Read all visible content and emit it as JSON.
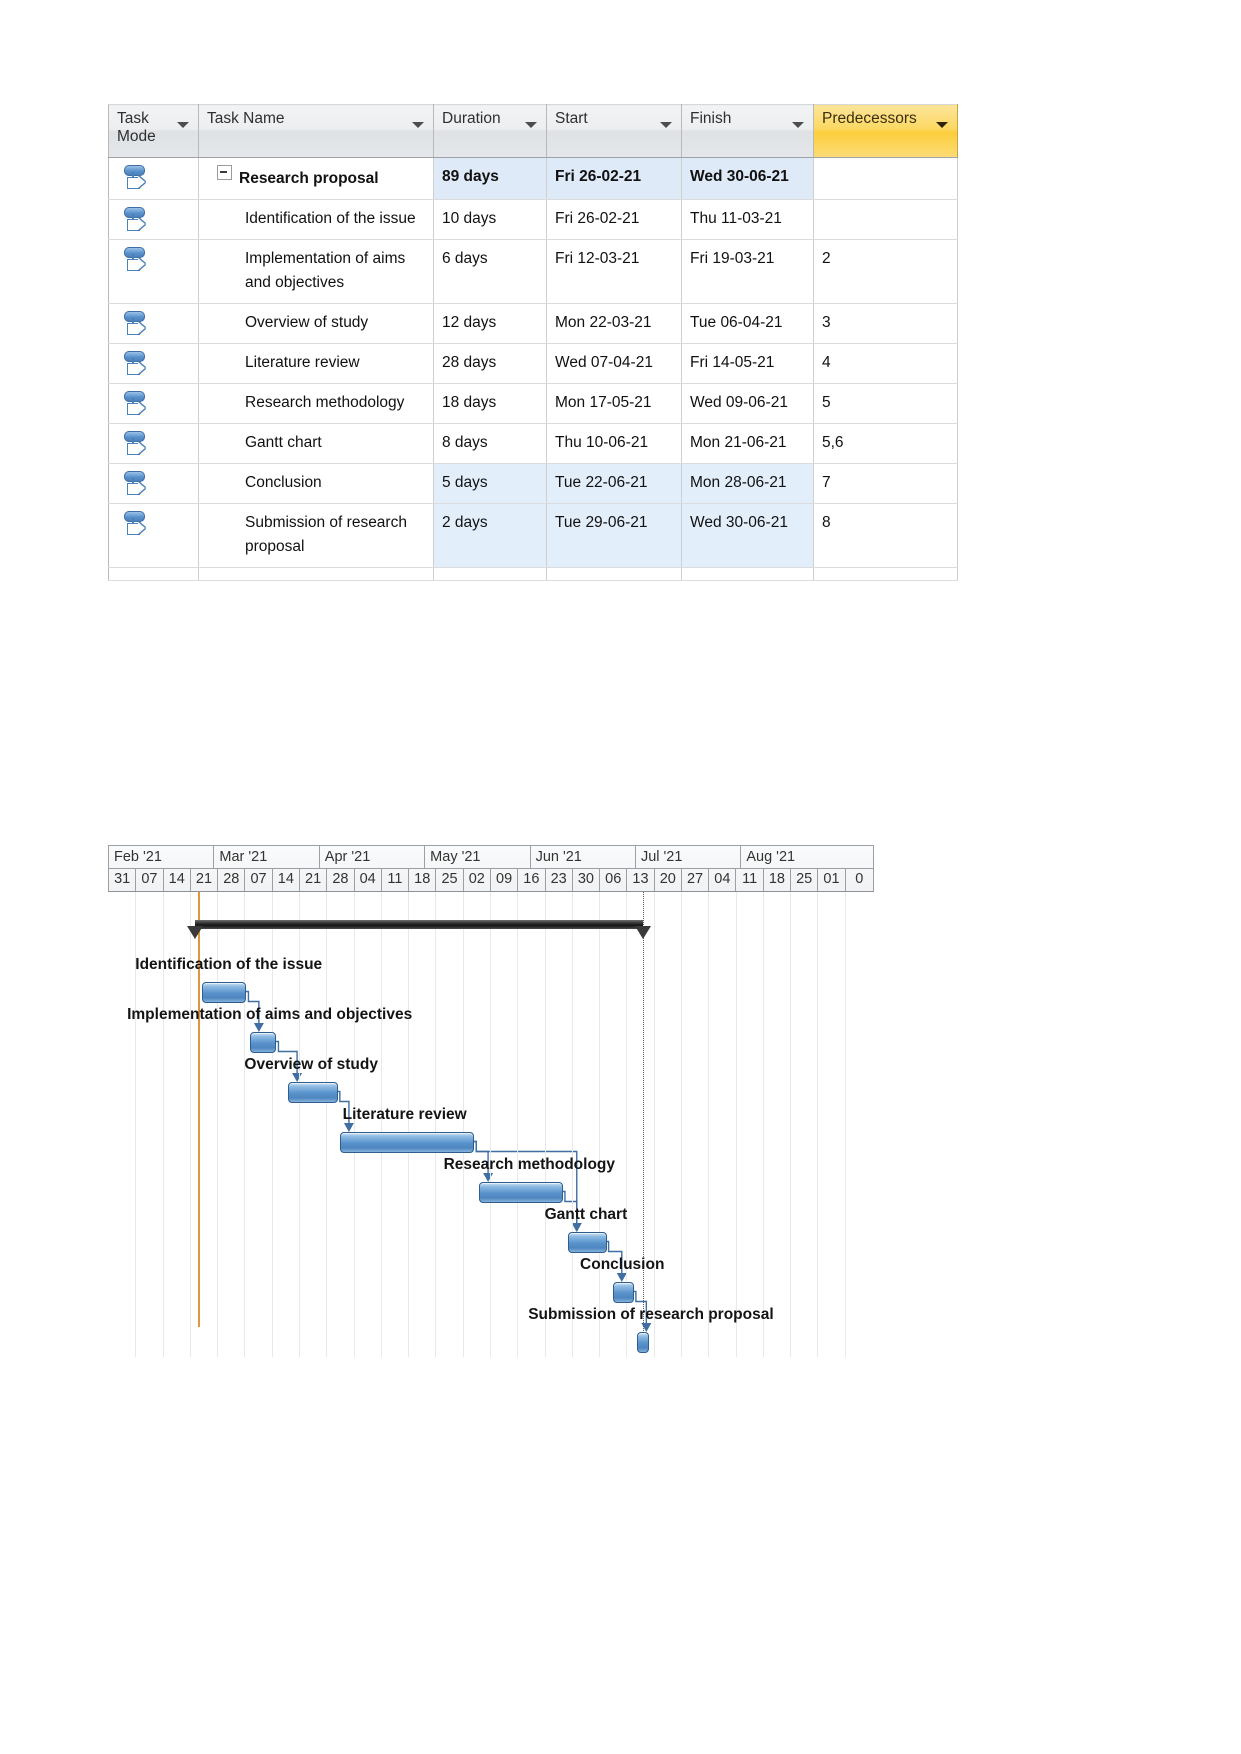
{
  "table": {
    "columns": [
      {
        "key": "mode",
        "label": "Task Mode"
      },
      {
        "key": "name",
        "label": "Task Name"
      },
      {
        "key": "dur",
        "label": "Duration"
      },
      {
        "key": "start",
        "label": "Start"
      },
      {
        "key": "finish",
        "label": "Finish"
      },
      {
        "key": "pred",
        "label": "Predecessors"
      }
    ],
    "header_highlight_color": "#fbce3c",
    "row_highlight_color": "#e3eefb",
    "rows": [
      {
        "id": 1,
        "name": "Research proposal",
        "dur": "89 days",
        "start": "Fri 26-02-21",
        "finish": "Wed 30-06-21",
        "pred": "",
        "summary": true,
        "indent": false,
        "highlight": true,
        "mode_icon": "auto-schedule-icon"
      },
      {
        "id": 2,
        "name": "Identification of the issue",
        "dur": "10 days",
        "start": "Fri 26-02-21",
        "finish": "Thu 11-03-21",
        "pred": "",
        "summary": false,
        "indent": true,
        "highlight": false,
        "mode_icon": "auto-schedule-icon"
      },
      {
        "id": 3,
        "name": "Implementation of aims and objectives",
        "dur": "6 days",
        "start": "Fri 12-03-21",
        "finish": "Fri 19-03-21",
        "pred": "2",
        "summary": false,
        "indent": true,
        "highlight": false,
        "mode_icon": "auto-schedule-icon"
      },
      {
        "id": 4,
        "name": "Overview of study",
        "dur": "12 days",
        "start": "Mon 22-03-21",
        "finish": "Tue 06-04-21",
        "pred": "3",
        "summary": false,
        "indent": true,
        "highlight": false,
        "mode_icon": "auto-schedule-icon"
      },
      {
        "id": 5,
        "name": "Literature review",
        "dur": "28 days",
        "start": "Wed 07-04-21",
        "finish": "Fri 14-05-21",
        "pred": "4",
        "summary": false,
        "indent": true,
        "highlight": false,
        "mode_icon": "auto-schedule-icon"
      },
      {
        "id": 6,
        "name": "Research methodology",
        "dur": "18 days",
        "start": "Mon 17-05-21",
        "finish": "Wed 09-06-21",
        "pred": "5",
        "summary": false,
        "indent": true,
        "highlight": false,
        "mode_icon": "auto-schedule-icon"
      },
      {
        "id": 7,
        "name": "Gantt chart",
        "dur": "8 days",
        "start": "Thu 10-06-21",
        "finish": "Mon 21-06-21",
        "pred": "5,6",
        "summary": false,
        "indent": true,
        "highlight": false,
        "mode_icon": "auto-schedule-icon"
      },
      {
        "id": 8,
        "name": "Conclusion",
        "dur": "5 days",
        "start": "Tue 22-06-21",
        "finish": "Mon 28-06-21",
        "pred": "7",
        "summary": false,
        "indent": true,
        "highlight": true,
        "mode_icon": "auto-schedule-icon"
      },
      {
        "id": 9,
        "name": "Submission of research proposal",
        "dur": "2 days",
        "start": "Tue 29-06-21",
        "finish": "Wed 30-06-21",
        "pred": "8",
        "summary": false,
        "indent": true,
        "highlight": true,
        "mode_icon": "auto-schedule-icon"
      }
    ]
  },
  "chart_data": {
    "type": "bar",
    "title": "",
    "timescale": {
      "months": [
        {
          "label": "Feb '21",
          "weeks": 4
        },
        {
          "label": "Mar '21",
          "weeks": 4
        },
        {
          "label": "Apr '21",
          "weeks": 4
        },
        {
          "label": "May '21",
          "weeks": 4
        },
        {
          "label": "Jun '21",
          "weeks": 4
        },
        {
          "label": "Jul '21",
          "weeks": 4
        },
        {
          "label": "Aug '21",
          "weeks": 5
        }
      ],
      "weeks": [
        "31",
        "07",
        "14",
        "21",
        "28",
        "07",
        "14",
        "21",
        "28",
        "04",
        "11",
        "18",
        "25",
        "02",
        "09",
        "16",
        "23",
        "30",
        "06",
        "13",
        "20",
        "27",
        "04",
        "11",
        "18",
        "25",
        "01",
        "0"
      ]
    },
    "summary_bar": {
      "label": "Research proposal",
      "start_week": 3.2,
      "end_week": 19.6
    },
    "today_marker_week": 3.3,
    "deadline_marker_week": 19.6,
    "bars": [
      {
        "name": "Identification of the issue",
        "start_week": 3.45,
        "end_week": 5.0,
        "label_x_week": 1.0
      },
      {
        "name": "Implementation of aims and objectives",
        "start_week": 5.2,
        "end_week": 6.1,
        "label_x_week": 0.7
      },
      {
        "name": "Overview of study",
        "start_week": 6.6,
        "end_week": 8.35,
        "label_x_week": 5.0
      },
      {
        "name": "Literature review",
        "start_week": 8.5,
        "end_week": 13.35,
        "label_x_week": 8.6
      },
      {
        "name": "Research methodology",
        "start_week": 13.6,
        "end_week": 16.6,
        "label_x_week": 12.3
      },
      {
        "name": "Gantt chart",
        "start_week": 16.85,
        "end_week": 18.2,
        "label_x_week": 16.0
      },
      {
        "name": "Conclusion",
        "start_week": 18.5,
        "end_week": 19.2,
        "label_x_week": 17.3
      },
      {
        "name": "Submission of research proposal",
        "start_week": 19.4,
        "end_week": 19.75,
        "label_x_week": 15.4
      }
    ],
    "links": [
      {
        "from": "Identification of the issue",
        "to": "Implementation of aims and objectives"
      },
      {
        "from": "Implementation of aims and objectives",
        "to": "Overview of study"
      },
      {
        "from": "Overview of study",
        "to": "Literature review"
      },
      {
        "from": "Literature review",
        "to": "Research methodology"
      },
      {
        "from": "Literature review",
        "to": "Gantt chart"
      },
      {
        "from": "Research methodology",
        "to": "Gantt chart"
      },
      {
        "from": "Gantt chart",
        "to": "Conclusion"
      },
      {
        "from": "Conclusion",
        "to": "Submission of research proposal"
      }
    ],
    "colors": {
      "bar_fill": "#5a93cc",
      "bar_border": "#2f5d8c",
      "summary_bar": "#2b2b2b",
      "today_line": "#e0953f",
      "link_line": "#3f6ea3"
    }
  }
}
